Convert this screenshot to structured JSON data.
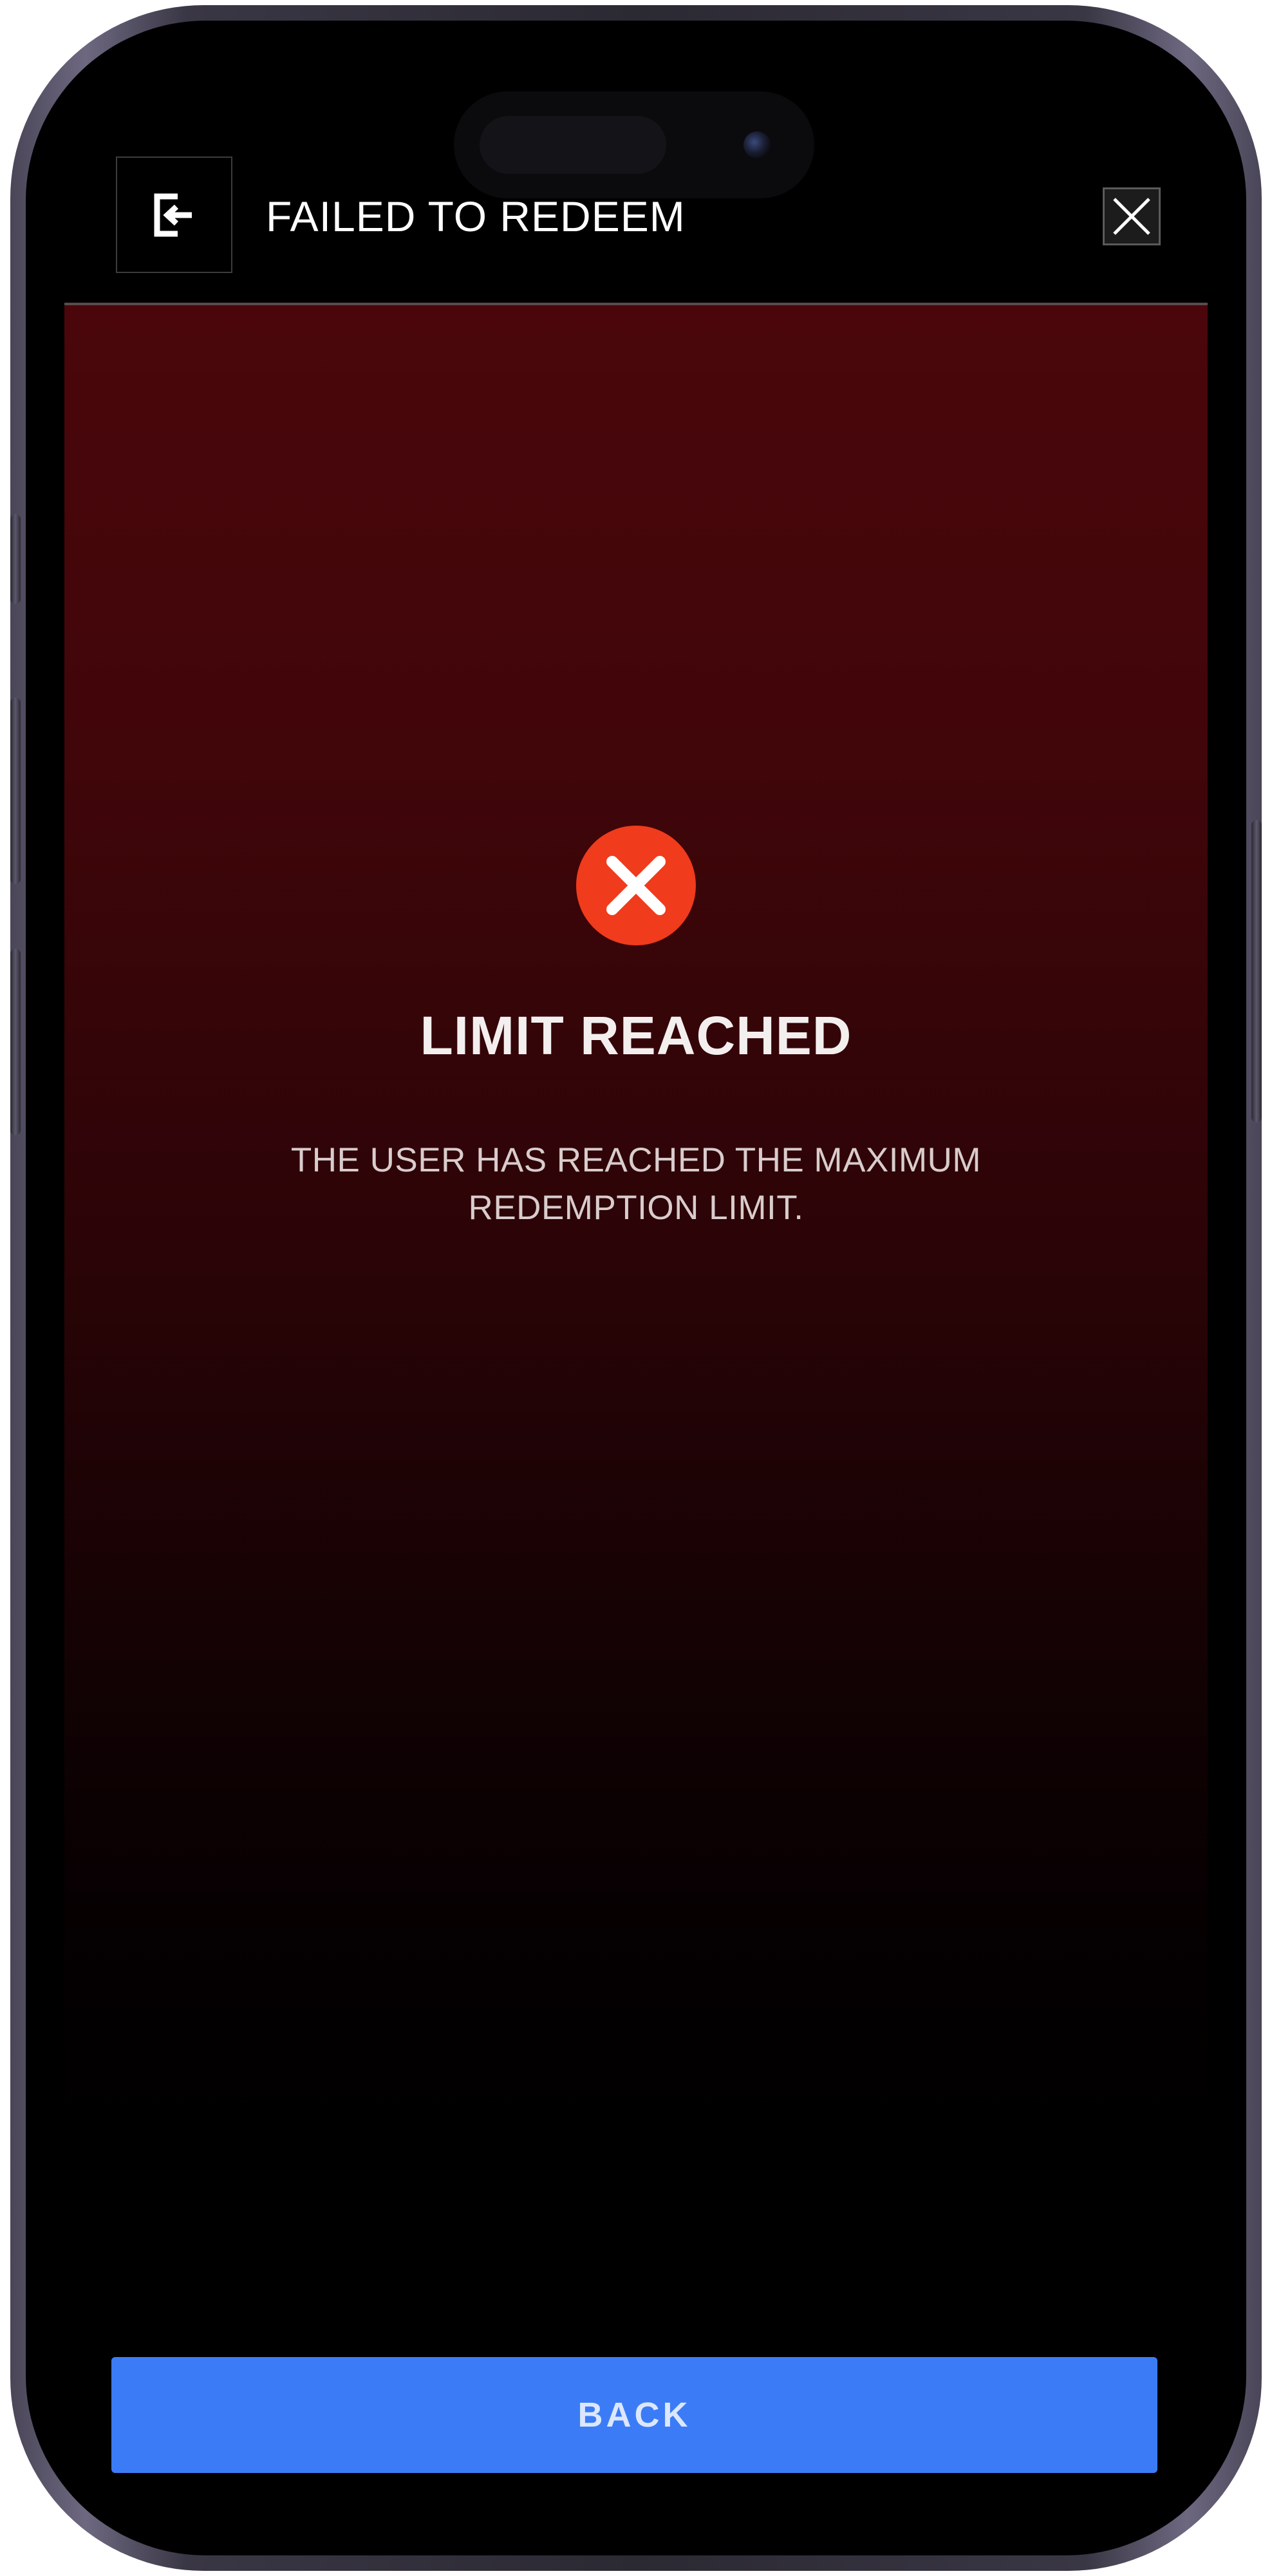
{
  "header": {
    "title": "FAILED TO REDEEM",
    "exit_icon": "exit-icon",
    "close_icon": "close-icon"
  },
  "status": {
    "icon": "error-x-icon",
    "icon_color": "#f03b1c",
    "headline": "LIMIT REACHED",
    "message": "THE USER HAS REACHED THE MAXIMUM REDEMPTION LIMIT."
  },
  "actions": {
    "back_label": "BACK",
    "back_color": "#3b7cf6"
  },
  "theme": {
    "panel_color_top": "#4a060b",
    "panel_color_bottom": "#000000"
  }
}
